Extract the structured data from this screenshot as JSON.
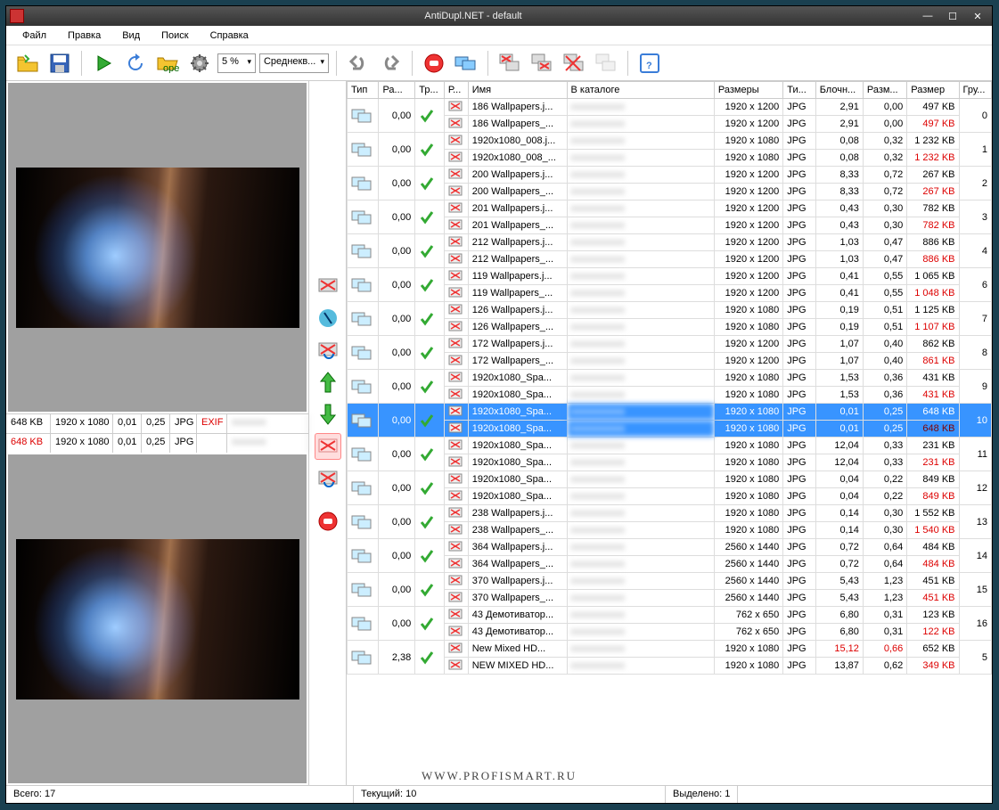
{
  "window": {
    "title": "AntiDupl.NET - default"
  },
  "menu": {
    "file": "Файл",
    "edit": "Правка",
    "view": "Вид",
    "search": "Поиск",
    "help": "Справка"
  },
  "toolbar": {
    "threshold": "5 %",
    "algorithm": "Среднекв..."
  },
  "previews": {
    "top": {
      "size_kb": "648 KB",
      "dims": "1920 x 1080",
      "diff": "0,01",
      "metric": "0,25",
      "fmt": "JPG",
      "exif": "EXIF"
    },
    "bottom": {
      "size_kb": "648 KB",
      "dims": "1920 x 1080",
      "diff": "0,01",
      "metric": "0,25",
      "fmt": "JPG"
    }
  },
  "columns": {
    "type": "Тип",
    "diff": "Ра...",
    "transform": "Тр...",
    "hint": "Р...",
    "name": "Имя",
    "folder": "В каталоге",
    "dims": "Размеры",
    "fmt": "Ти...",
    "block": "Блочн...",
    "metric": "Разм...",
    "size": "Размер",
    "group": "Гру..."
  },
  "rows": [
    {
      "group": "0",
      "diff": "0,00",
      "a": {
        "name": "186 Wallpapers.j...",
        "dims": "1920 x 1200",
        "fmt": "JPG",
        "block": "2,91",
        "metric": "0,00",
        "size": "497 KB"
      },
      "b": {
        "name": "186 Wallpapers_...",
        "dims": "1920 x 1200",
        "fmt": "JPG",
        "block": "2,91",
        "metric": "0,00",
        "size": "497 KB",
        "sizeRed": true
      }
    },
    {
      "group": "1",
      "diff": "0,00",
      "a": {
        "name": "1920x1080_008.j...",
        "dims": "1920 x 1080",
        "fmt": "JPG",
        "block": "0,08",
        "metric": "0,32",
        "size": "1 232 KB"
      },
      "b": {
        "name": "1920x1080_008_...",
        "dims": "1920 x 1080",
        "fmt": "JPG",
        "block": "0,08",
        "metric": "0,32",
        "size": "1 232 KB",
        "sizeRed": true
      }
    },
    {
      "group": "2",
      "diff": "0,00",
      "a": {
        "name": "200 Wallpapers.j...",
        "dims": "1920 x 1200",
        "fmt": "JPG",
        "block": "8,33",
        "metric": "0,72",
        "size": "267 KB"
      },
      "b": {
        "name": "200 Wallpapers_...",
        "dims": "1920 x 1200",
        "fmt": "JPG",
        "block": "8,33",
        "metric": "0,72",
        "size": "267 KB",
        "sizeRed": true
      }
    },
    {
      "group": "3",
      "diff": "0,00",
      "a": {
        "name": "201 Wallpapers.j...",
        "dims": "1920 x 1200",
        "fmt": "JPG",
        "block": "0,43",
        "metric": "0,30",
        "size": "782 KB"
      },
      "b": {
        "name": "201 Wallpapers_...",
        "dims": "1920 x 1200",
        "fmt": "JPG",
        "block": "0,43",
        "metric": "0,30",
        "size": "782 KB",
        "sizeRed": true
      }
    },
    {
      "group": "4",
      "diff": "0,00",
      "a": {
        "name": "212 Wallpapers.j...",
        "dims": "1920 x 1200",
        "fmt": "JPG",
        "block": "1,03",
        "metric": "0,47",
        "size": "886 KB"
      },
      "b": {
        "name": "212 Wallpapers_...",
        "dims": "1920 x 1200",
        "fmt": "JPG",
        "block": "1,03",
        "metric": "0,47",
        "size": "886 KB",
        "sizeRed": true
      }
    },
    {
      "group": "6",
      "diff": "0,00",
      "a": {
        "name": "119 Wallpapers.j...",
        "dims": "1920 x 1200",
        "fmt": "JPG",
        "block": "0,41",
        "metric": "0,55",
        "size": "1 065 KB"
      },
      "b": {
        "name": "119 Wallpapers_...",
        "dims": "1920 x 1200",
        "fmt": "JPG",
        "block": "0,41",
        "metric": "0,55",
        "size": "1 048 KB",
        "sizeRed": true
      }
    },
    {
      "group": "7",
      "diff": "0,00",
      "a": {
        "name": "126 Wallpapers.j...",
        "dims": "1920 x 1080",
        "fmt": "JPG",
        "block": "0,19",
        "metric": "0,51",
        "size": "1 125 KB"
      },
      "b": {
        "name": "126 Wallpapers_...",
        "dims": "1920 x 1080",
        "fmt": "JPG",
        "block": "0,19",
        "metric": "0,51",
        "size": "1 107 KB",
        "sizeRed": true
      }
    },
    {
      "group": "8",
      "diff": "0,00",
      "a": {
        "name": "172 Wallpapers.j...",
        "dims": "1920 x 1200",
        "fmt": "JPG",
        "block": "1,07",
        "metric": "0,40",
        "size": "862 KB"
      },
      "b": {
        "name": "172 Wallpapers_...",
        "dims": "1920 x 1200",
        "fmt": "JPG",
        "block": "1,07",
        "metric": "0,40",
        "size": "861 KB",
        "sizeRed": true
      }
    },
    {
      "group": "9",
      "diff": "0,00",
      "a": {
        "name": "1920x1080_Spa...",
        "dims": "1920 x 1080",
        "fmt": "JPG",
        "block": "1,53",
        "metric": "0,36",
        "size": "431 KB"
      },
      "b": {
        "name": "1920x1080_Spa...",
        "dims": "1920 x 1080",
        "fmt": "JPG",
        "block": "1,53",
        "metric": "0,36",
        "size": "431 KB",
        "sizeRed": true
      }
    },
    {
      "group": "10",
      "diff": "0,00",
      "selected": true,
      "a": {
        "name": "1920x1080_Spa...",
        "dims": "1920 x 1080",
        "fmt": "JPG",
        "block": "0,01",
        "metric": "0,25",
        "size": "648 KB"
      },
      "b": {
        "name": "1920x1080_Spa...",
        "dims": "1920 x 1080",
        "fmt": "JPG",
        "block": "0,01",
        "metric": "0,25",
        "size": "648 KB",
        "sizeRed": true
      }
    },
    {
      "group": "11",
      "diff": "0,00",
      "a": {
        "name": "1920x1080_Spa...",
        "dims": "1920 x 1080",
        "fmt": "JPG",
        "block": "12,04",
        "metric": "0,33",
        "size": "231 KB"
      },
      "b": {
        "name": "1920x1080_Spa...",
        "dims": "1920 x 1080",
        "fmt": "JPG",
        "block": "12,04",
        "metric": "0,33",
        "size": "231 KB",
        "sizeRed": true
      }
    },
    {
      "group": "12",
      "diff": "0,00",
      "a": {
        "name": "1920x1080_Spa...",
        "dims": "1920 x 1080",
        "fmt": "JPG",
        "block": "0,04",
        "metric": "0,22",
        "size": "849 KB"
      },
      "b": {
        "name": "1920x1080_Spa...",
        "dims": "1920 x 1080",
        "fmt": "JPG",
        "block": "0,04",
        "metric": "0,22",
        "size": "849 KB",
        "sizeRed": true
      }
    },
    {
      "group": "13",
      "diff": "0,00",
      "a": {
        "name": "238 Wallpapers.j...",
        "dims": "1920 x 1080",
        "fmt": "JPG",
        "block": "0,14",
        "metric": "0,30",
        "size": "1 552 KB"
      },
      "b": {
        "name": "238 Wallpapers_...",
        "dims": "1920 x 1080",
        "fmt": "JPG",
        "block": "0,14",
        "metric": "0,30",
        "size": "1 540 KB",
        "sizeRed": true
      }
    },
    {
      "group": "14",
      "diff": "0,00",
      "a": {
        "name": "364 Wallpapers.j...",
        "dims": "2560 x 1440",
        "fmt": "JPG",
        "block": "0,72",
        "metric": "0,64",
        "size": "484 KB"
      },
      "b": {
        "name": "364 Wallpapers_...",
        "dims": "2560 x 1440",
        "fmt": "JPG",
        "block": "0,72",
        "metric": "0,64",
        "size": "484 KB",
        "sizeRed": true
      }
    },
    {
      "group": "15",
      "diff": "0,00",
      "a": {
        "name": "370 Wallpapers.j...",
        "dims": "2560 x 1440",
        "fmt": "JPG",
        "block": "5,43",
        "metric": "1,23",
        "size": "451 KB"
      },
      "b": {
        "name": "370 Wallpapers_...",
        "dims": "2560 x 1440",
        "fmt": "JPG",
        "block": "5,43",
        "metric": "1,23",
        "size": "451 KB",
        "sizeRed": true
      }
    },
    {
      "group": "16",
      "diff": "0,00",
      "a": {
        "name": "43 Демотиватор...",
        "dims": "762 x 650",
        "fmt": "JPG",
        "block": "6,80",
        "metric": "0,31",
        "size": "123 KB"
      },
      "b": {
        "name": "43 Демотиватор...",
        "dims": "762 x 650",
        "fmt": "JPG",
        "block": "6,80",
        "metric": "0,31",
        "size": "122 KB",
        "sizeRed": true
      }
    },
    {
      "group": "5",
      "diff": "2,38",
      "a": {
        "name": "New Mixed HD...",
        "dims": "1920 x 1080",
        "fmt": "JPG",
        "block": "15,12",
        "blockRed": true,
        "metric": "0,66",
        "metricRed": true,
        "size": "652 KB"
      },
      "b": {
        "name": "NEW MIXED HD...",
        "dims": "1920 x 1080",
        "fmt": "JPG",
        "block": "13,87",
        "metric": "0,62",
        "size": "349 KB",
        "sizeRed": true
      }
    }
  ],
  "status": {
    "total_label": "Всего:",
    "total": "17",
    "current_label": "Текущий:",
    "current": "10",
    "selected_label": "Выделено:",
    "selected": "1"
  },
  "watermark": "WWW.PROFISMART.RU"
}
